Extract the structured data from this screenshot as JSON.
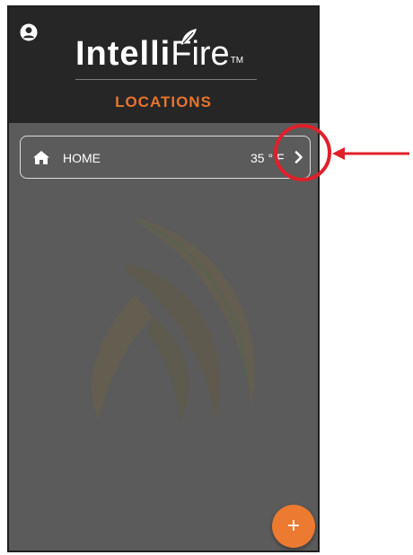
{
  "header": {
    "logo_bold": "Intelli",
    "logo_light": "Fire",
    "logo_tm": "TM",
    "title": "LOCATIONS"
  },
  "locations": [
    {
      "name": "HOME",
      "temperature": "35 ° F",
      "icon": "home-icon"
    }
  ],
  "fab": {
    "label": "+"
  },
  "icons": {
    "user": "user-icon",
    "home": "home-icon",
    "chevron": "chevron-right-icon",
    "add": "plus-icon"
  },
  "colors": {
    "accent": "#e8742e",
    "header_bg": "#262626",
    "body_bg": "#5b5b5b",
    "annotation": "#e0202a"
  }
}
